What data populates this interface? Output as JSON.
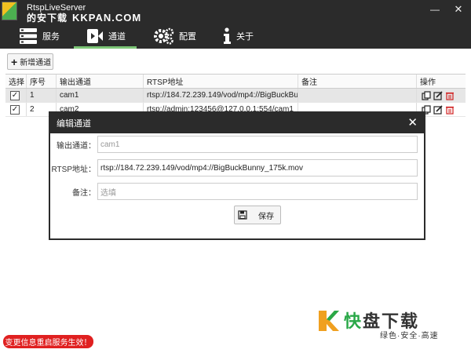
{
  "window": {
    "title": "RtspLiveServer",
    "watermark_cn": "的安下载",
    "watermark_en": "KKPAN.COM",
    "minimize": "—",
    "close": "✕"
  },
  "nav": {
    "service": "服务",
    "channel": "通道",
    "config": "配置",
    "about": "关于",
    "active": "channel",
    "accent_color": "#7cc576"
  },
  "toolbar": {
    "add_channel": "新增通道"
  },
  "table": {
    "headers": [
      "选择",
      "序号",
      "输出通道",
      "RTSP地址",
      "备注",
      "操作"
    ],
    "rows": [
      {
        "checked": "✓",
        "num": "1",
        "output": "cam1",
        "rtsp": "rtsp://184.72.239.149/vod/mp4://BigBuckBun",
        "note": ""
      },
      {
        "checked": "✓",
        "num": "2",
        "output": "cam2",
        "rtsp": "rtsp://admin:123456@127.0.0.1:554/cam1",
        "note": ""
      }
    ]
  },
  "modal": {
    "title": "编辑通道",
    "close": "✕",
    "output_label": "输出通道：",
    "output_value": "cam1",
    "rtsp_label": "RTSP地址：",
    "rtsp_value": "rtsp://184.72.239.149/vod/mp4://BigBuckBunny_175k.mov",
    "note_label": "备注：",
    "note_placeholder": "选填",
    "save_label": "保存"
  },
  "status": {
    "message": "变更信息重启服务生效！",
    "color": "#e02020"
  },
  "brand": {
    "name_a": "快",
    "name_b": "盘下载",
    "tagline": "绿色·安全·高速"
  }
}
